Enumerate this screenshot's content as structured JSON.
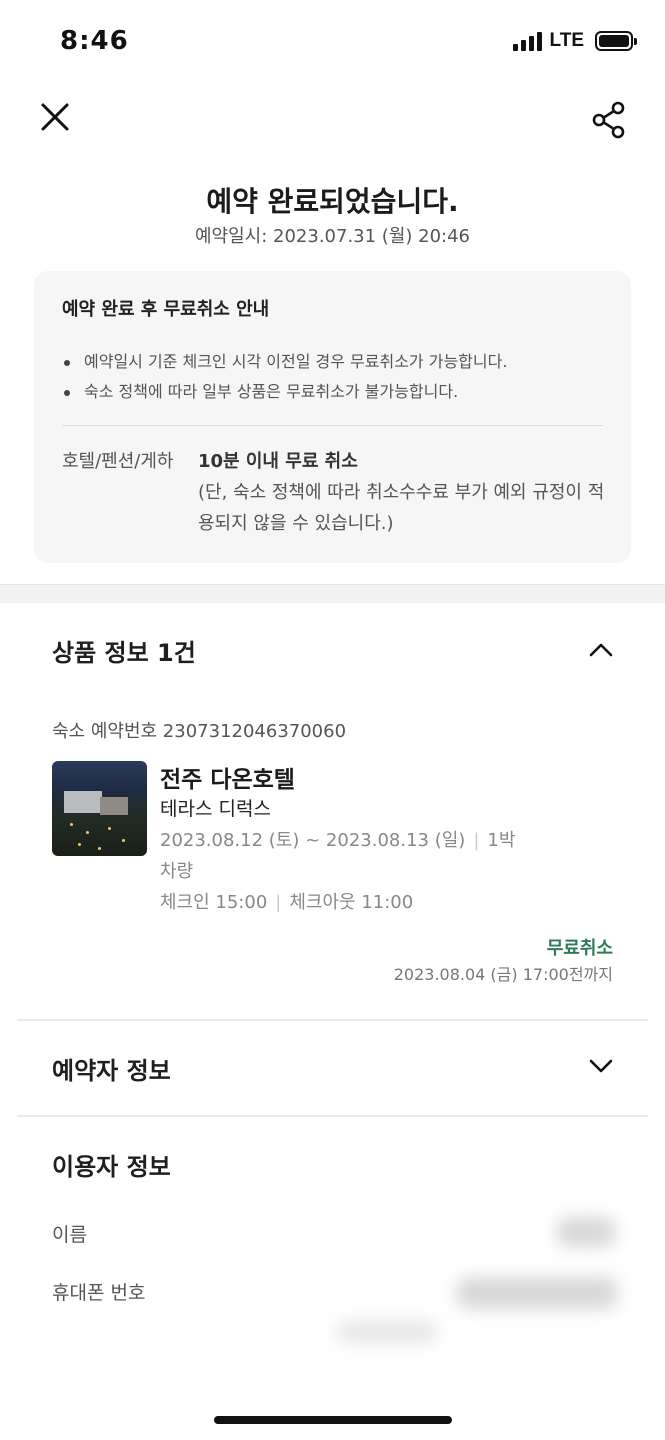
{
  "status_bar": {
    "time": "8:46",
    "network": "LTE"
  },
  "header": {
    "title": "예약 완료되었습니다.",
    "reserved_at": "예약일시: 2023.07.31 (월) 20:46"
  },
  "notice": {
    "title": "예약 완료 후 무료취소 안내",
    "items": [
      "예약일시 기준 체크인 시각 이전일 경우 무료취소가 가능합니다.",
      "숙소 정책에 따라 일부 상품은 무료취소가 불가능합니다."
    ],
    "policy_label": "호텔/펜션/게하",
    "policy_main": "10분 이내 무료 취소",
    "policy_note": "(단, 숙소 정책에 따라 취소수수료 부가 예외 규정이 적용되지 않을 수 있습니다.)"
  },
  "product": {
    "header": "상품 정보 1건",
    "booking_no": "숙소 예약번호 2307312046370060",
    "hotel_name": "전주 다온호텔",
    "room_type": "테라스 디럭스",
    "dates": "2023.08.12 (토) ~ 2023.08.13 (일)",
    "nights": "1박",
    "parking": "차량",
    "checkin": "체크인 15:00",
    "checkout": "체크아웃 11:00",
    "free_cancel": "무료취소",
    "cancel_deadline": "2023.08.04 (금) 17:00전까지"
  },
  "booker": {
    "title": "예약자 정보"
  },
  "guest": {
    "title": "이용자 정보",
    "name_label": "이름",
    "phone_label": "휴대폰 번호"
  },
  "colors": {
    "accent_green": "#2f7a5a",
    "notice_bg": "#f6f6f6"
  }
}
